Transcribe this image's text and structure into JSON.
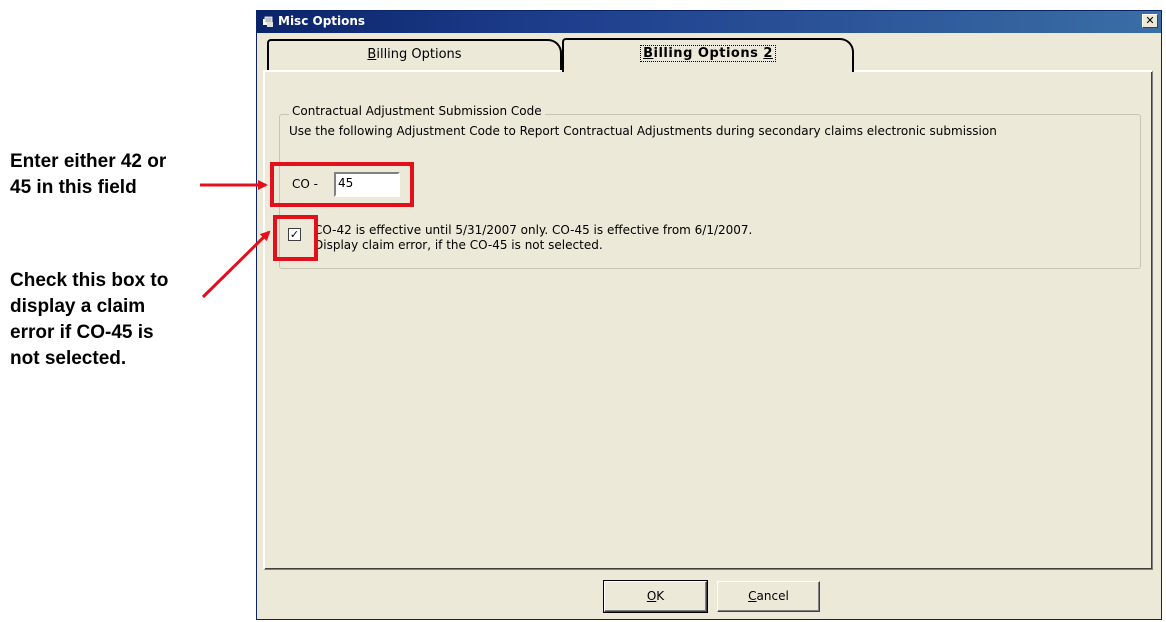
{
  "annotations": {
    "field_note": [
      "Enter either 42 or",
      "45 in this field"
    ],
    "checkbox_note": [
      "Check this box to",
      "display a claim",
      "error if CO-45 is",
      "not selected."
    ]
  },
  "window": {
    "title": "Misc Options",
    "close_glyph": "✕"
  },
  "tabs": [
    {
      "label": "Billing Options",
      "mnemonic": "B",
      "rest": "illing Options",
      "active": false
    },
    {
      "label": "Billing Options 2",
      "mnemonic": "B",
      "rest": "illing Options ",
      "suffix": "2",
      "active": true
    }
  ],
  "group": {
    "title": "Contractual Adjustment Submission Code",
    "description": "Use the following Adjustment Code to Report Contractual Adjustments during secondary claims electronic submission",
    "co_label": "CO -",
    "co_value": "45",
    "checkbox_checked": true,
    "checkbox_line1": "CO-42 is effective until 5/31/2007 only.  CO-45 is effective from 6/1/2007.",
    "checkbox_line2": "Display claim error, if the CO-45 is not selected."
  },
  "buttons": {
    "ok_mnemonic": "O",
    "ok_rest": "K",
    "cancel_mnemonic": "C",
    "cancel_rest": "ancel"
  },
  "colors": {
    "highlight": "#e3101b",
    "dialog_bg": "#ece9d8",
    "titlebar": "#0a246a"
  }
}
